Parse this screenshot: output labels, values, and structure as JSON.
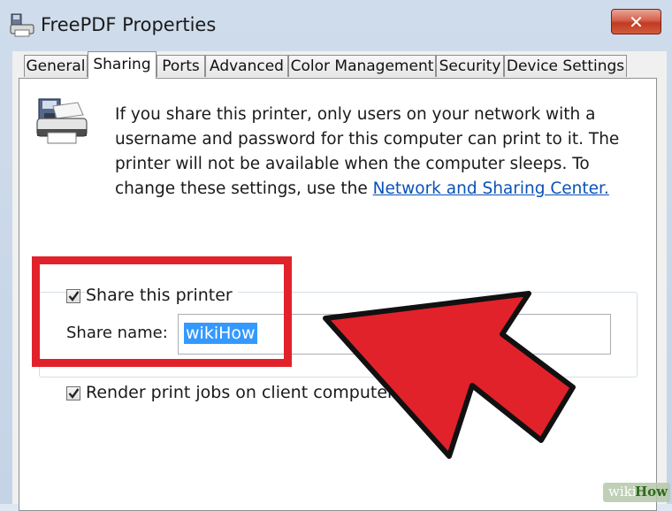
{
  "window": {
    "title": "FreePDF Properties",
    "close_label": "✕"
  },
  "tabs": [
    {
      "label": "General"
    },
    {
      "label": "Sharing"
    },
    {
      "label": "Ports"
    },
    {
      "label": "Advanced"
    },
    {
      "label": "Color Management"
    },
    {
      "label": "Security"
    },
    {
      "label": "Device Settings"
    }
  ],
  "sharing": {
    "info_text": "If you share this printer, only users on your network with a username and password for this computer can print to it. The printer will not be available when the computer sleeps. To change these settings, use the ",
    "info_link": "Network and Sharing Center.",
    "share_checkbox_label": "Share this printer",
    "share_checked": true,
    "share_name_label": "Share name:",
    "share_name_value": "wikiHow",
    "render_checkbox_label": "Render print jobs on client computers",
    "render_checked": true
  },
  "annotation": {
    "highlight_color": "#e2222a"
  },
  "watermark": {
    "part1": "wiki",
    "part2": "How"
  }
}
